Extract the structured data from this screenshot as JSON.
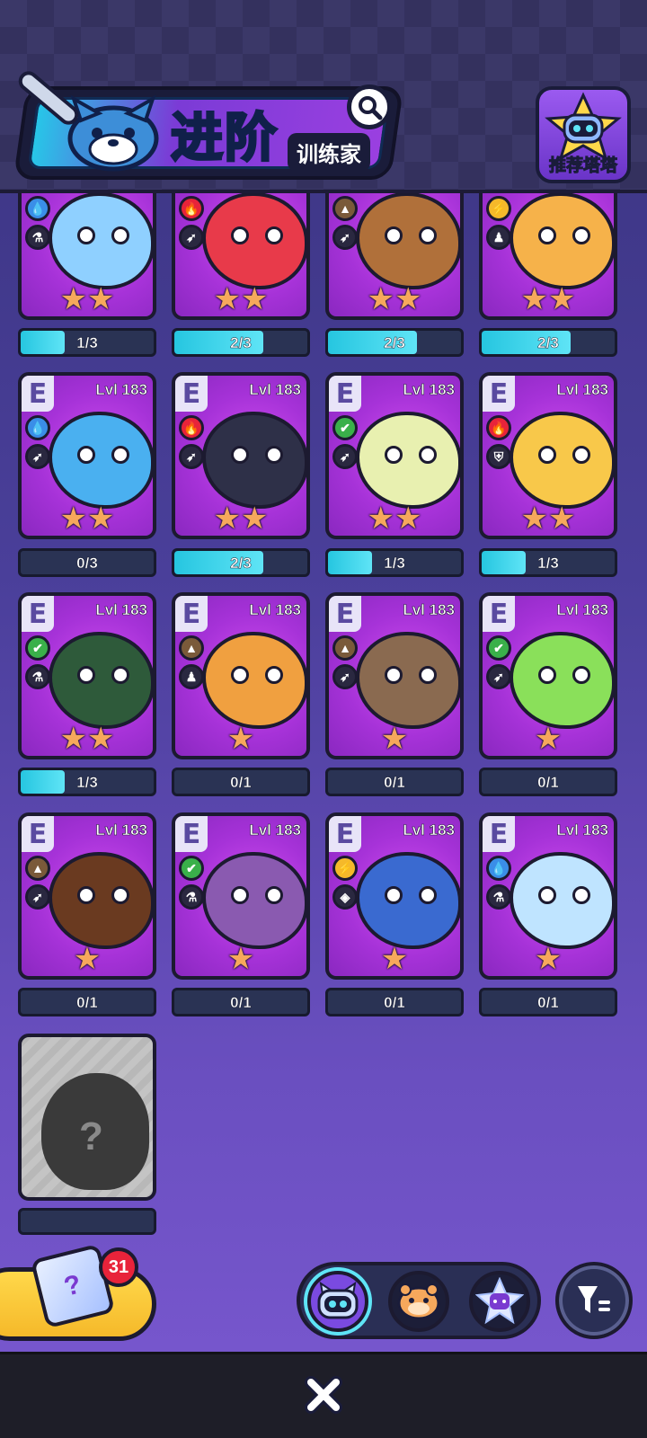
{
  "header": {
    "title": "进阶",
    "subtitle": "训练家",
    "recommend_label": "推荐塔塔"
  },
  "cards": [
    {
      "level": "",
      "element": "water",
      "role": "support",
      "stars": 2,
      "progress": "1/3",
      "fill": 0.33,
      "color": "#8fd0ff"
    },
    {
      "level": "",
      "element": "fire",
      "role": "attack",
      "stars": 2,
      "progress": "2/3",
      "fill": 0.67,
      "color": "#e83a4a"
    },
    {
      "level": "",
      "element": "earth",
      "role": "attack",
      "stars": 2,
      "progress": "2/3",
      "fill": 0.67,
      "color": "#b0703a"
    },
    {
      "level": "",
      "element": "electric",
      "role": "special",
      "stars": 2,
      "progress": "2/3",
      "fill": 0.67,
      "color": "#f6b24a"
    },
    {
      "level": "Lvl 183",
      "element": "water",
      "role": "attack",
      "stars": 2,
      "progress": "0/3",
      "fill": 0,
      "color": "#4ab0f0"
    },
    {
      "level": "Lvl 183",
      "element": "fire",
      "role": "attack",
      "stars": 2,
      "progress": "2/3",
      "fill": 0.67,
      "color": "#2e3048"
    },
    {
      "level": "Lvl 183",
      "element": "grass",
      "role": "attack",
      "stars": 2,
      "progress": "1/3",
      "fill": 0.33,
      "color": "#e8f0b0"
    },
    {
      "level": "Lvl 183",
      "element": "fire",
      "role": "defense",
      "stars": 2,
      "progress": "1/3",
      "fill": 0.33,
      "color": "#f8c84a"
    },
    {
      "level": "Lvl 183",
      "element": "grass",
      "role": "support",
      "stars": 2,
      "progress": "1/3",
      "fill": 0.33,
      "color": "#2e5a3a"
    },
    {
      "level": "Lvl 183",
      "element": "earth",
      "role": "special",
      "stars": 1,
      "progress": "0/1",
      "fill": 0,
      "color": "#f0a040"
    },
    {
      "level": "Lvl 183",
      "element": "earth",
      "role": "attack",
      "stars": 1,
      "progress": "0/1",
      "fill": 0,
      "color": "#8a6a50"
    },
    {
      "level": "Lvl 183",
      "element": "grass",
      "role": "attack",
      "stars": 1,
      "progress": "0/1",
      "fill": 0,
      "color": "#8ae05a"
    },
    {
      "level": "Lvl 183",
      "element": "earth",
      "role": "attack",
      "stars": 1,
      "progress": "0/1",
      "fill": 0,
      "color": "#6a3a20"
    },
    {
      "level": "Lvl 183",
      "element": "grass",
      "role": "support",
      "stars": 1,
      "progress": "0/1",
      "fill": 0,
      "color": "#8a5ab0"
    },
    {
      "level": "Lvl 183",
      "element": "electric",
      "role": "vision",
      "stars": 1,
      "progress": "0/1",
      "fill": 0,
      "color": "#3a6ad0"
    },
    {
      "level": "Lvl 183",
      "element": "water",
      "role": "support",
      "stars": 1,
      "progress": "0/1",
      "fill": 0,
      "color": "#bfe4ff"
    }
  ],
  "locked_card": {
    "symbol": "?"
  },
  "gift": {
    "count": "31"
  },
  "tabs": [
    "tata-cat-icon",
    "hamster-icon",
    "star-cat-icon"
  ],
  "colors": {
    "accent": "#48e8f8",
    "card": "#b33ce0",
    "progress": "#26c6e0"
  }
}
